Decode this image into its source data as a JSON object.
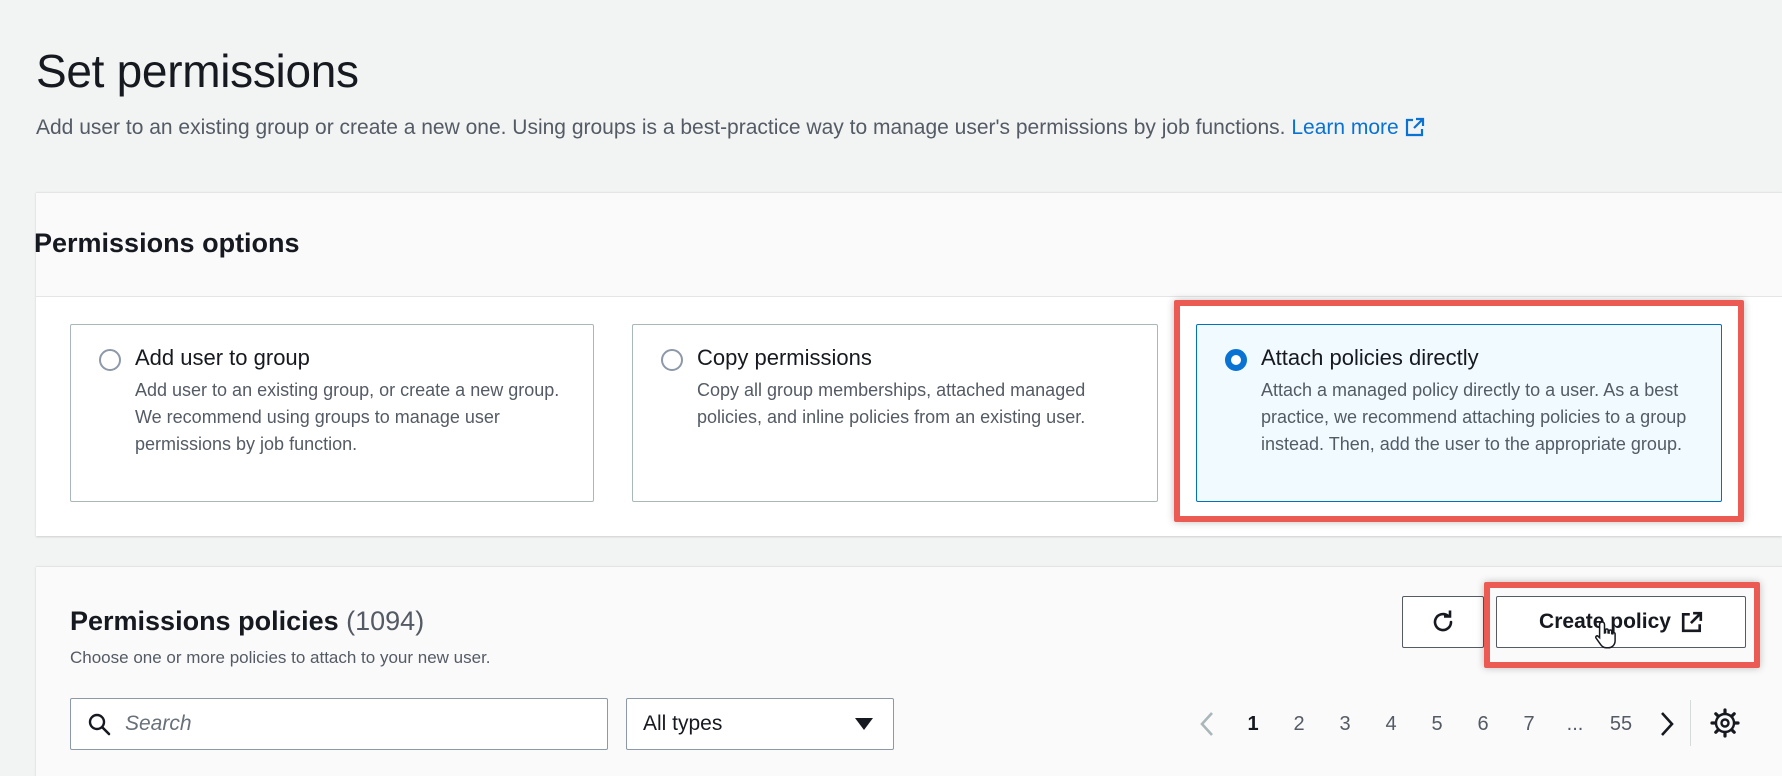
{
  "header": {
    "title": "Set permissions",
    "description": "Add user to an existing group or create a new one. Using groups is a best-practice way to manage user's permissions by job functions.",
    "learn_more": "Learn more"
  },
  "permissions_options": {
    "title": "Permissions options",
    "options": [
      {
        "label": "Add user to group",
        "description": "Add user to an existing group, or create a new group. We recommend using groups to manage user permissions by job function.",
        "selected": false
      },
      {
        "label": "Copy permissions",
        "description": "Copy all group memberships, attached managed policies, and inline policies from an existing user.",
        "selected": false
      },
      {
        "label": "Attach policies directly",
        "description": "Attach a managed policy directly to a user. As a best practice, we recommend attaching policies to a group instead. Then, add the user to the appropriate group.",
        "selected": true
      }
    ]
  },
  "permissions_policies": {
    "title": "Permissions policies",
    "count": "(1094)",
    "description": "Choose one or more policies to attach to your new user.",
    "create_policy_label": "Create policy",
    "search_placeholder": "Search",
    "type_filter": "All types",
    "pagination": {
      "pages": [
        "1",
        "2",
        "3",
        "4",
        "5",
        "6",
        "7",
        "...",
        "55"
      ],
      "current": "1"
    }
  },
  "colors": {
    "accent": "#0972d3",
    "highlight": "#ec5b53",
    "selected_bg": "#f1faff"
  }
}
